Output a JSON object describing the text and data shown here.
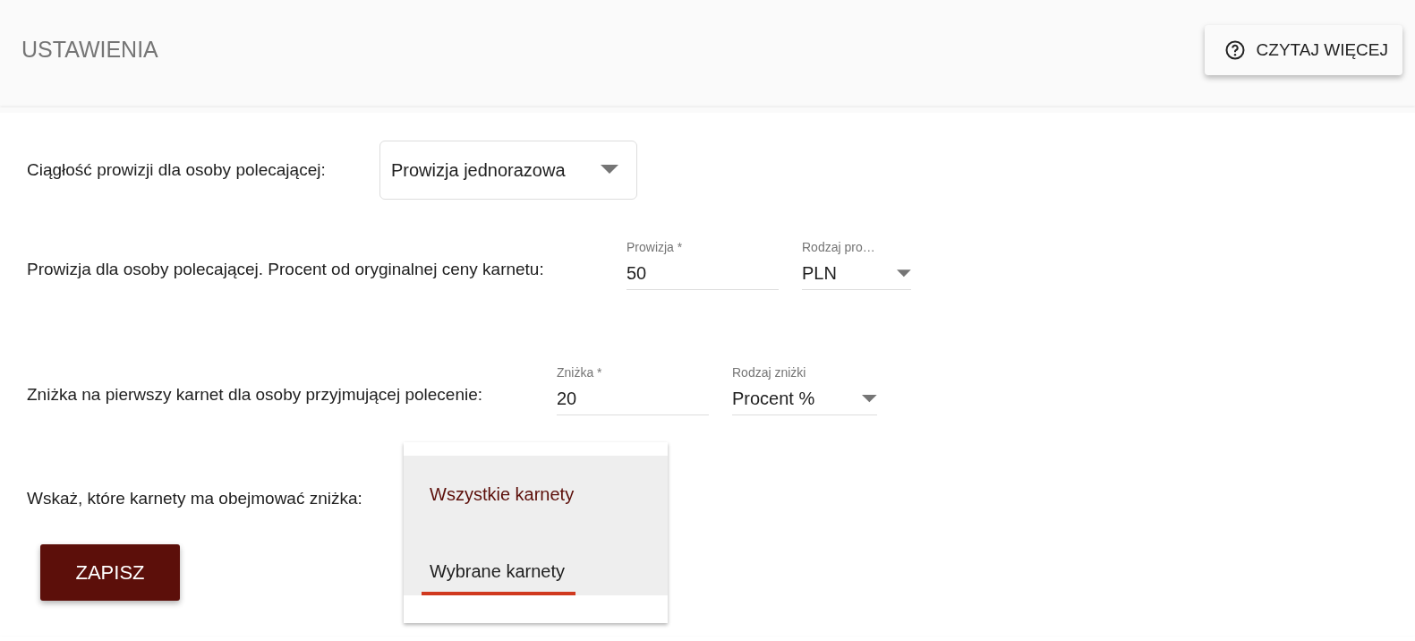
{
  "header": {
    "title": "USTAWIENIA",
    "help_button": "CZYTAJ WIĘCEJ"
  },
  "continuity": {
    "label": "Ciągłość prowizji dla osoby polecającej:",
    "select_value": "Prowizja jednorazowa"
  },
  "commission": {
    "label": "Prowizja dla osoby polecającej. Procent od oryginalnej ceny karnetu:",
    "field_label": "Prowizja *",
    "value": "50",
    "type_label": "Rodzaj pro…",
    "type_value": "PLN"
  },
  "discount": {
    "label": "Zniżka na pierwszy karnet dla osoby przyjmującej polecenie:",
    "field_label": "Zniżka *",
    "value": "20",
    "type_label": "Rodzaj zniżki",
    "type_value": "Procent %"
  },
  "scope": {
    "label": "Wskaż, które karnety ma obejmować zniżka:",
    "options": [
      {
        "label": "Wszystkie karnety",
        "selected": true
      },
      {
        "label": "Wybrane karnety",
        "selected": false
      }
    ]
  },
  "save_button": "ZAPISZ"
}
